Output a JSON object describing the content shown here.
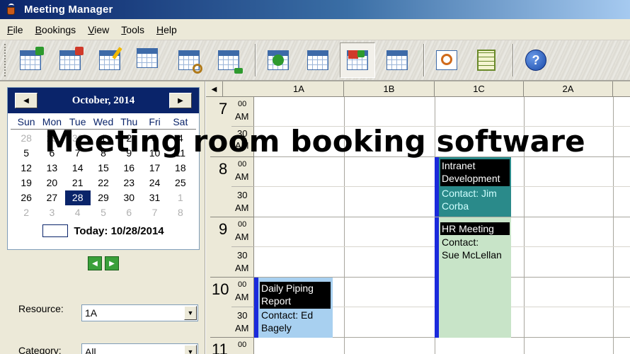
{
  "window": {
    "title": "Meeting Manager",
    "icon": "coffee-cup-icon"
  },
  "menu": [
    {
      "label": "File"
    },
    {
      "label": "Bookings"
    },
    {
      "label": "View"
    },
    {
      "label": "Tools"
    },
    {
      "label": "Help"
    }
  ],
  "toolbar": {
    "buttons": [
      {
        "icon": "new-booking-icon"
      },
      {
        "icon": "delete-booking-icon"
      },
      {
        "icon": "edit-booking-icon"
      },
      {
        "icon": "copy-booking-icon"
      },
      {
        "icon": "find-booking-icon"
      },
      {
        "icon": "export-booking-icon"
      },
      {
        "icon": "refresh-icon"
      },
      {
        "icon": "week-view-icon"
      },
      {
        "icon": "color-categories-icon"
      },
      {
        "icon": "month-view-icon"
      },
      {
        "icon": "print-preview-icon"
      },
      {
        "icon": "notes-icon"
      },
      {
        "icon": "help-icon",
        "glyph": "?"
      }
    ],
    "pressed": "color-categories-icon"
  },
  "calendar": {
    "month_label": "October, 2014",
    "prev": "◀",
    "next": "▶",
    "weekdays": [
      "Sun",
      "Mon",
      "Tue",
      "Wed",
      "Thu",
      "Fri",
      "Sat"
    ],
    "days": [
      [
        "28",
        "29",
        "30",
        "1",
        "2",
        "3",
        "4"
      ],
      [
        "5",
        "6",
        "7",
        "8",
        "9",
        "10",
        "11"
      ],
      [
        "12",
        "13",
        "14",
        "15",
        "16",
        "17",
        "18"
      ],
      [
        "19",
        "20",
        "21",
        "22",
        "23",
        "24",
        "25"
      ],
      [
        "26",
        "27",
        "28",
        "29",
        "30",
        "31",
        "1"
      ],
      [
        "2",
        "3",
        "4",
        "5",
        "6",
        "7",
        "8"
      ]
    ],
    "selected_day": "28",
    "today_label": "Today: 10/28/2014"
  },
  "filters": {
    "resource_label": "Resource:",
    "resource_value": "1A",
    "category_label": "Category:",
    "category_value": "All"
  },
  "schedule": {
    "columns": [
      "1A",
      "1B",
      "1C",
      "2A"
    ],
    "hours": [
      {
        "hour": "7",
        "minutes": "00",
        "ampm": "AM",
        "half": "30",
        "half_ampm": "AM"
      },
      {
        "hour": "8",
        "minutes": "00",
        "ampm": "AM",
        "half": "30",
        "half_ampm": "AM"
      },
      {
        "hour": "9",
        "minutes": "00",
        "ampm": "AM",
        "half": "30",
        "half_ampm": "AM"
      },
      {
        "hour": "10",
        "minutes": "00",
        "ampm": "AM",
        "half": "30",
        "half_ampm": "AM"
      },
      {
        "hour": "11",
        "minutes": "00",
        "ampm": "",
        "half": "",
        "half_ampm": ""
      }
    ],
    "appointments": [
      {
        "title": "Intranet Development",
        "title_lines": [
          "Intranet",
          "Development"
        ],
        "contact_lines": [
          "Contact: Jim",
          "Corba"
        ],
        "room": "1C",
        "color": "#2a8a8a"
      },
      {
        "title": "HR Meeting",
        "title_lines": [
          "HR Meeting"
        ],
        "contact_lines": [
          "Contact:",
          "Sue McLellan"
        ],
        "room": "1C",
        "color": "#c8e4c8"
      },
      {
        "title": "Daily Piping Report",
        "title_lines": [
          "Daily Piping",
          "Report"
        ],
        "contact_lines": [
          "Contact: Ed",
          "Bagely"
        ],
        "room": "1A",
        "color": "#a8d0f0"
      }
    ]
  },
  "overlay_caption": "Meeting room booking software"
}
